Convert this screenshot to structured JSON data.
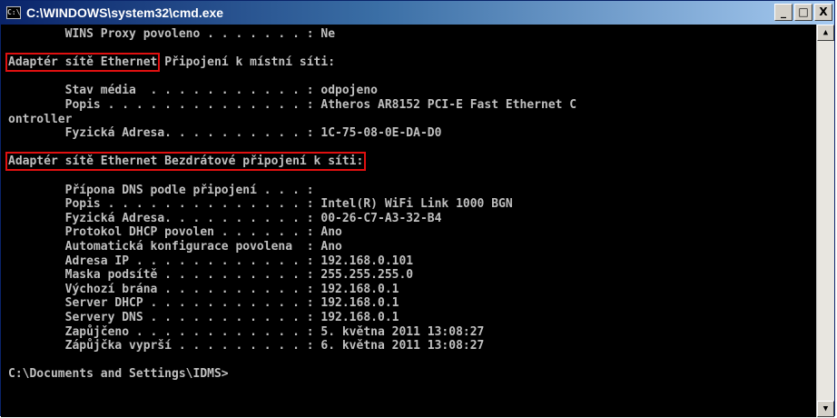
{
  "window": {
    "title": "C:\\WINDOWS\\system32\\cmd.exe",
    "icon_label": "C:\\",
    "controls": {
      "minimize": "_",
      "maximize": "□",
      "close": "X"
    }
  },
  "console": {
    "lines": [
      "        WINS Proxy povoleno . . . . . . . : Ne",
      "",
      "Adaptér sítě Ethernet Připojení k místní síti:",
      "",
      "        Stav média  . . . . . . . . . . . : odpojeno",
      "        Popis . . . . . . . . . . . . . . : Atheros AR8152 PCI-E Fast Ethernet C",
      "ontroller",
      "        Fyzická Adresa. . . . . . . . . . : 1C-75-08-0E-DA-D0",
      "",
      "Adaptér sítě Ethernet Bezdrátové připojení k síti:",
      "",
      "        Přípona DNS podle připojení . . . :",
      "        Popis . . . . . . . . . . . . . . : Intel(R) WiFi Link 1000 BGN",
      "        Fyzická Adresa. . . . . . . . . . : 00-26-C7-A3-32-B4",
      "        Protokol DHCP povolen . . . . . . : Ano",
      "        Automatická konfigurace povolena  : Ano",
      "        Adresa IP . . . . . . . . . . . . : 192.168.0.101",
      "        Maska podsítě . . . . . . . . . . : 255.255.255.0",
      "        Výchozí brána . . . . . . . . . . : 192.168.0.1",
      "        Server DHCP . . . . . . . . . . . : 192.168.0.1",
      "        Servery DNS . . . . . . . . . . . : 192.168.0.1",
      "        Zapůjčeno . . . . . . . . . . . . : 5. května 2011 13:08:27",
      "        Zápůjčka vyprší . . . . . . . . . : 6. května 2011 13:08:27",
      "",
      "C:\\Documents and Settings\\IDMS>"
    ],
    "highlight_color": "#e01010",
    "text_color": "#c0c0c0",
    "background_color": "#000000",
    "highlighted_line_numbers": [
      3,
      10
    ]
  },
  "scrollbar": {
    "up_arrow": "▲",
    "down_arrow": "▼"
  }
}
